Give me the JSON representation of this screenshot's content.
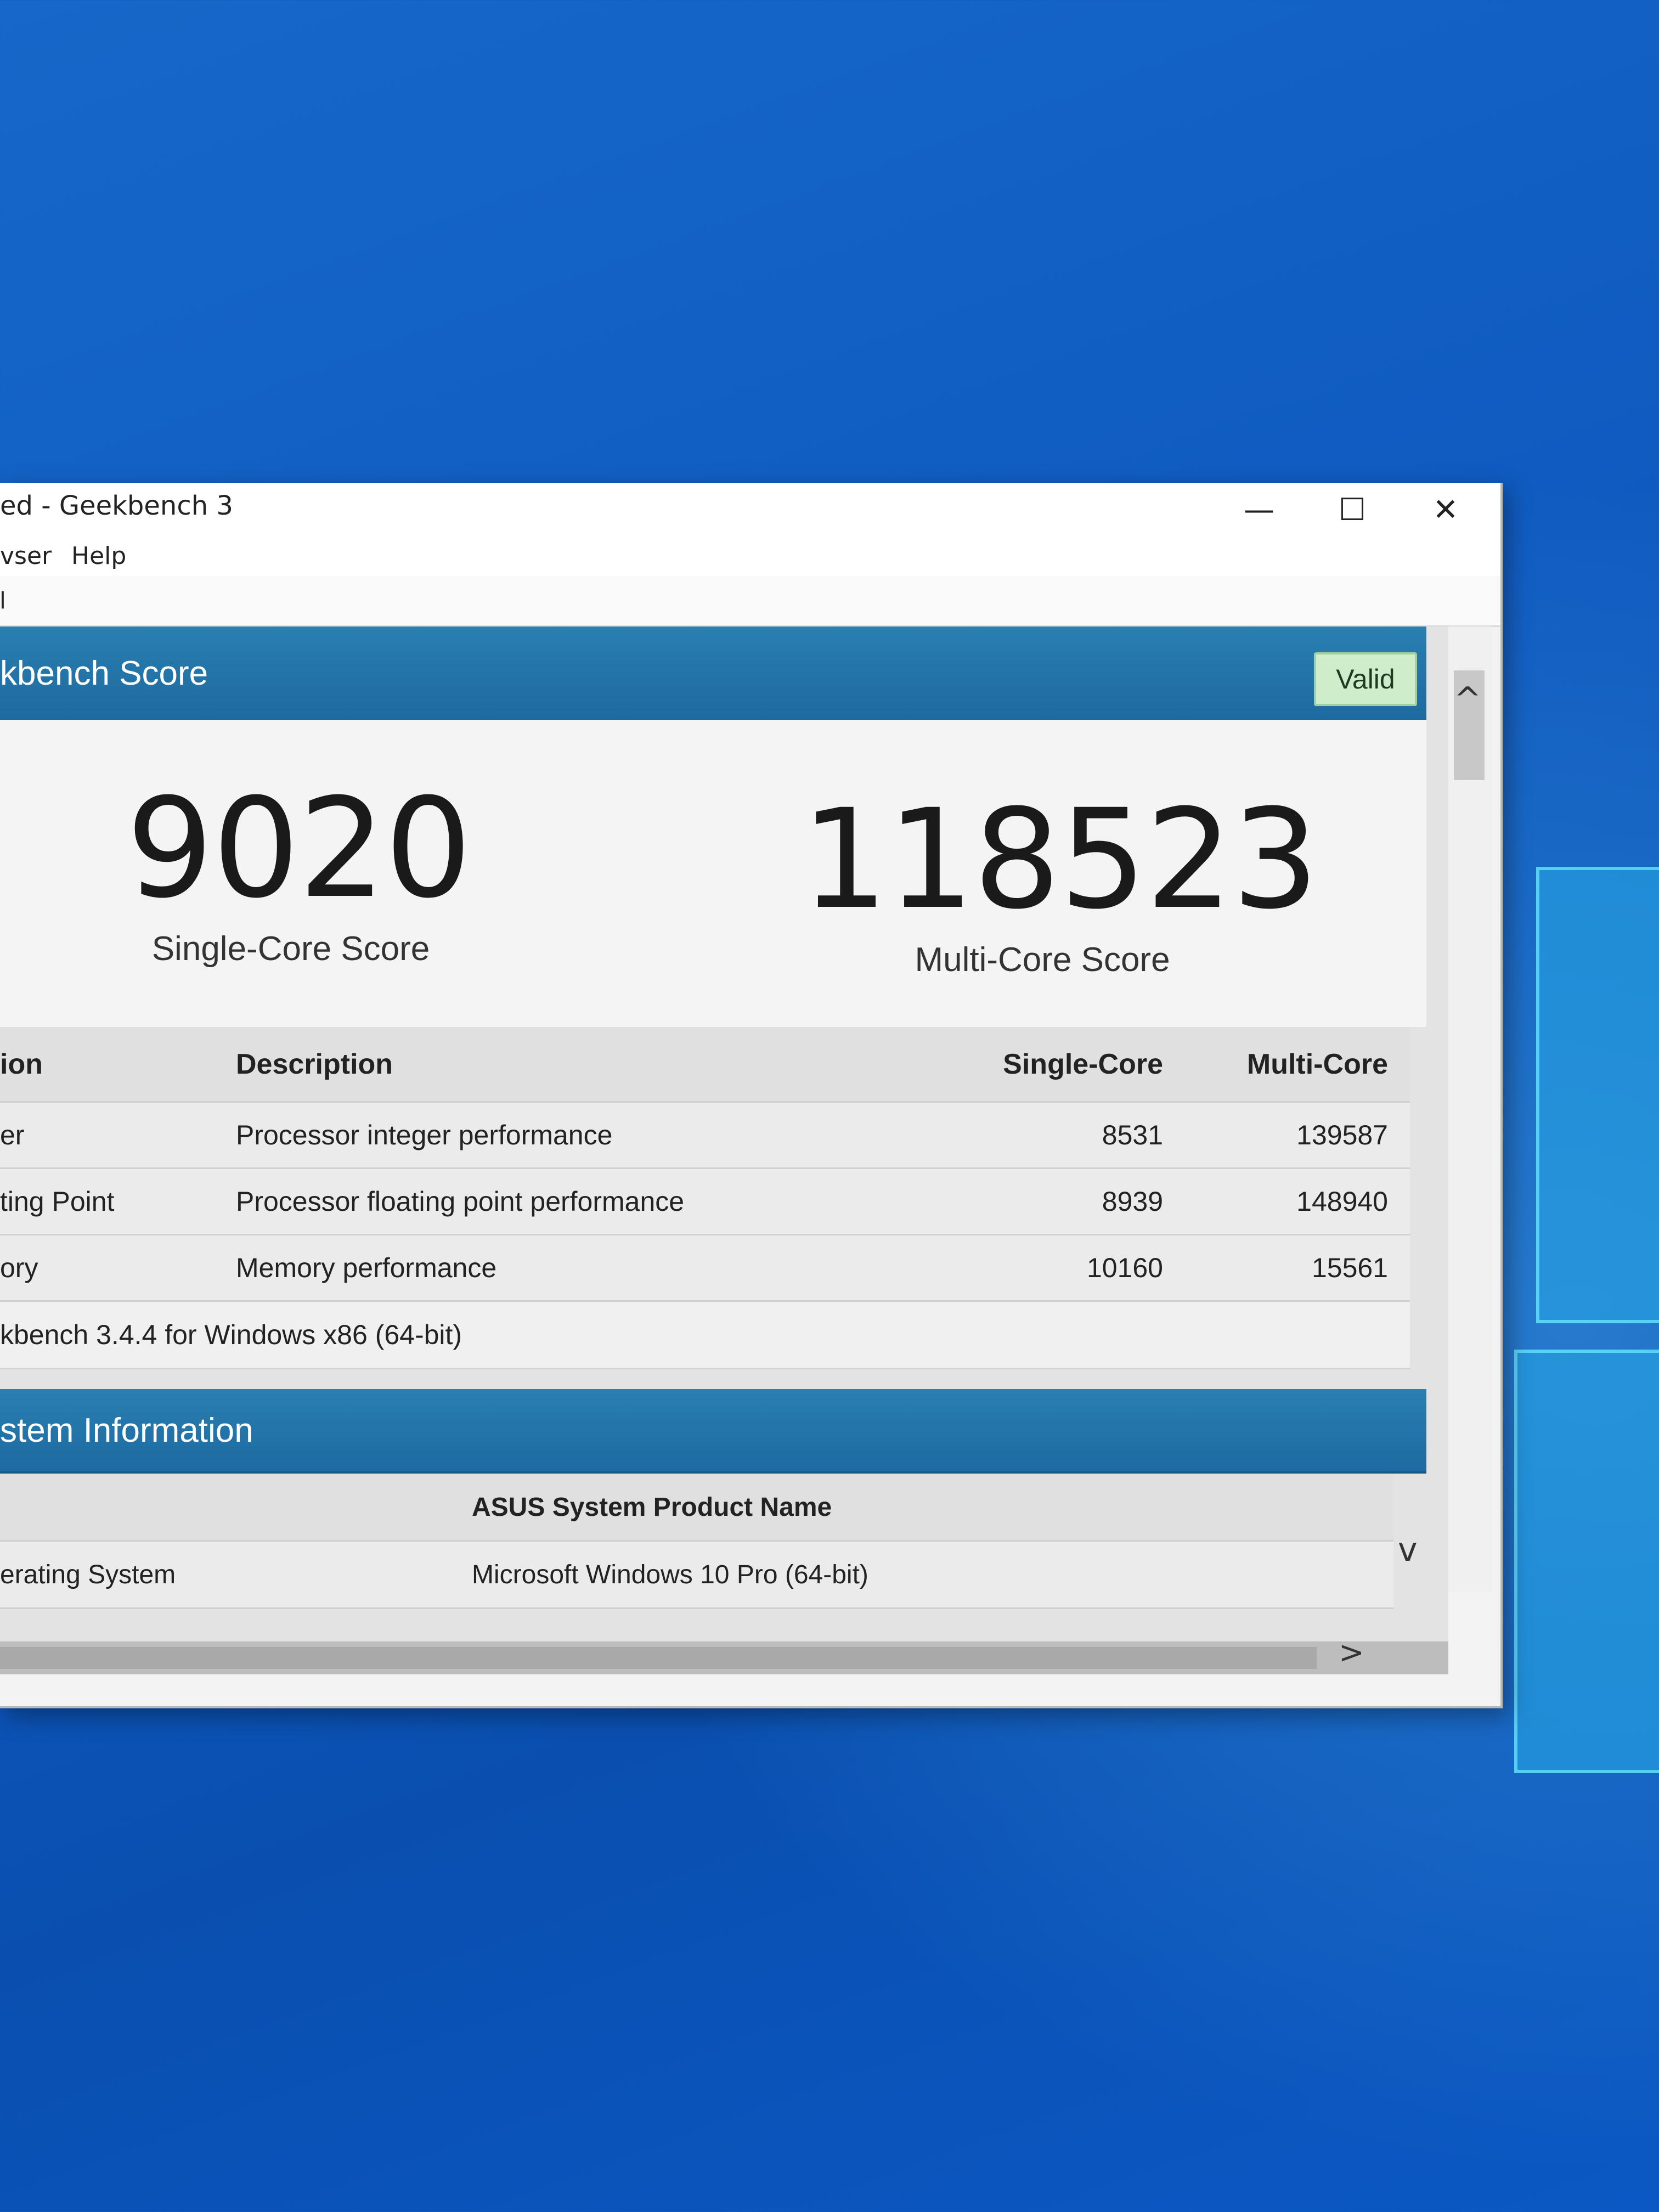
{
  "window": {
    "title": "ed - Geekbench 3",
    "controls": {
      "minimize": "—",
      "maximize": "☐",
      "close": "✕"
    }
  },
  "menu": {
    "browser": "vser",
    "help": "Help"
  },
  "toolbar": {
    "item": "l"
  },
  "score_section": {
    "title": "kbench Score",
    "badge": "Valid",
    "single_core": {
      "value": "9020",
      "label": "Single-Core Score"
    },
    "multi_core": {
      "value": "118523",
      "label": "Multi-Core Score"
    }
  },
  "results": {
    "columns": [
      "ion",
      "Description",
      "Single-Core",
      "Multi-Core"
    ],
    "rows": [
      {
        "name": "er",
        "description": "Processor integer performance",
        "single": "8531",
        "multi": "139587"
      },
      {
        "name": "ting Point",
        "description": "Processor floating point performance",
        "single": "8939",
        "multi": "148940"
      },
      {
        "name": "ory",
        "description": "Memory performance",
        "single": "10160",
        "multi": "15561"
      }
    ],
    "footer": "kbench 3.4.4 for Windows x86 (64-bit)"
  },
  "system_info": {
    "title": "stem Information",
    "rows": [
      {
        "label": "",
        "value": "ASUS System Product Name"
      },
      {
        "label": "erating System",
        "value": "Microsoft Windows 10 Pro (64-bit)"
      }
    ]
  },
  "scroll": {
    "up": "^",
    "down": "v",
    "right": ">"
  },
  "colors": {
    "desktop": "#0f5ac0",
    "section_header": "#1d6aa0",
    "valid_badge": "#cfeccb"
  }
}
